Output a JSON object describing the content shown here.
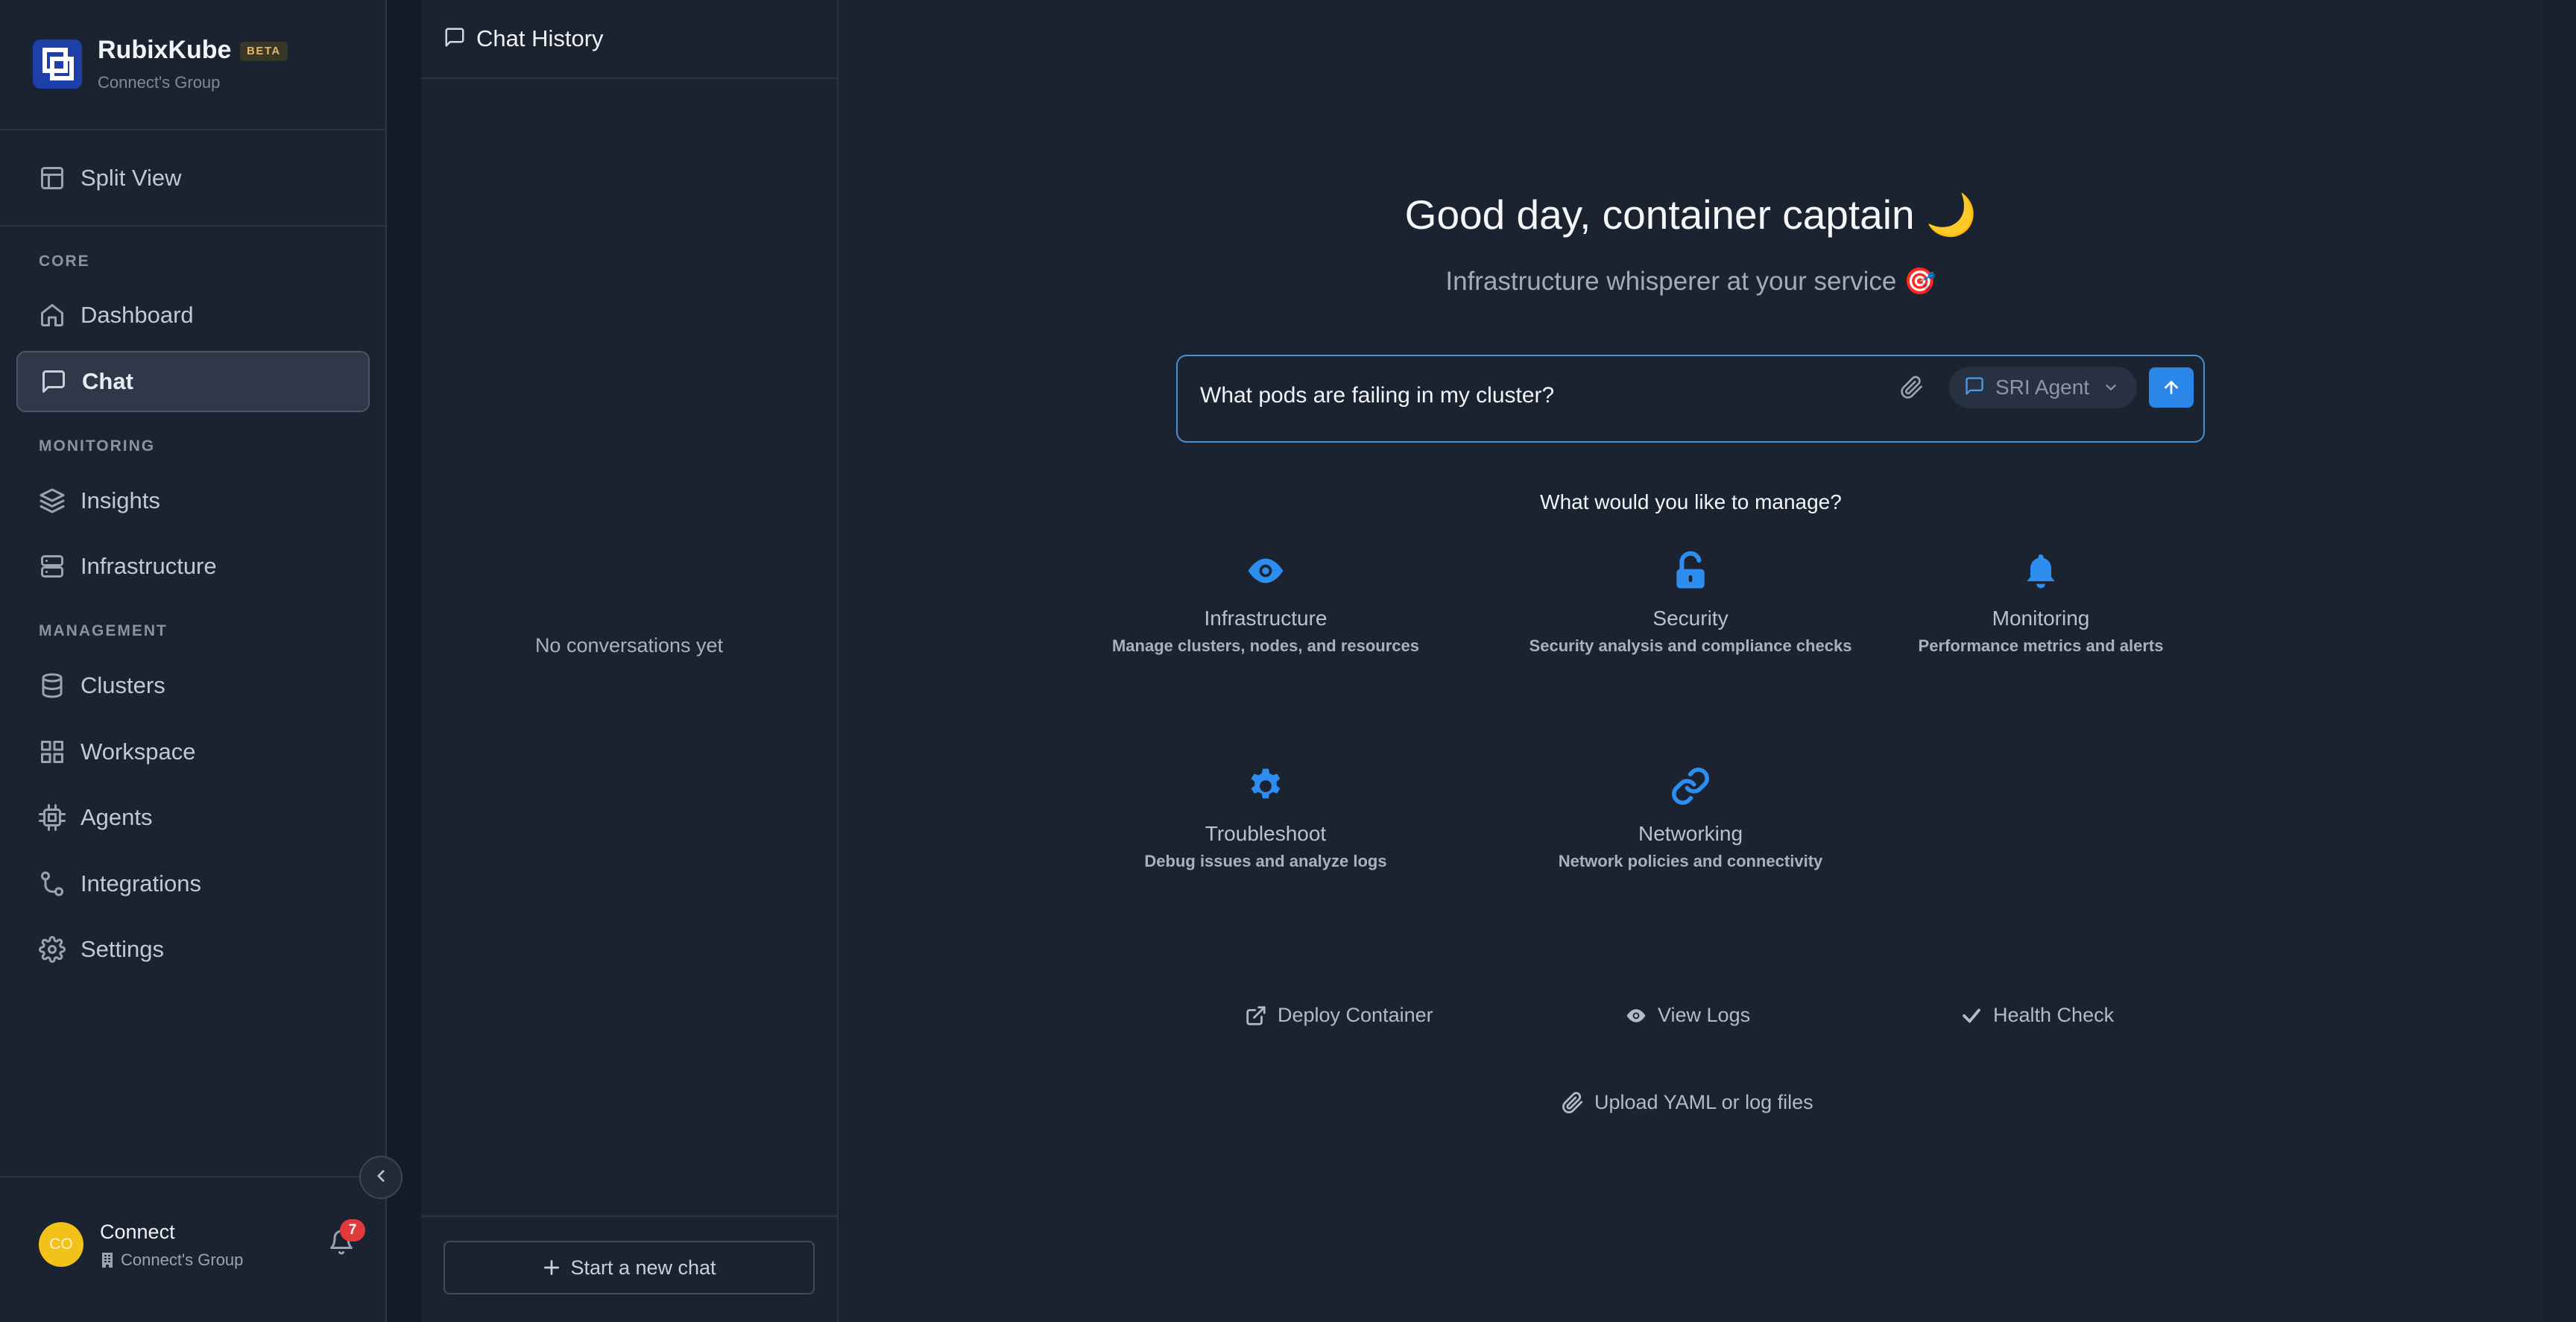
{
  "brand": {
    "name": "RubixKube",
    "badge": "BETA",
    "subtitle": "Connect's Group"
  },
  "sidebar": {
    "split_view": "Split View",
    "sections": [
      {
        "title": "CORE",
        "items": [
          {
            "label": "Dashboard",
            "icon": "home-icon"
          },
          {
            "label": "Chat",
            "icon": "chat-icon",
            "active": true
          }
        ]
      },
      {
        "title": "MONITORING",
        "items": [
          {
            "label": "Insights",
            "icon": "layers-icon"
          },
          {
            "label": "Infrastructure",
            "icon": "server-icon"
          }
        ]
      },
      {
        "title": "MANAGEMENT",
        "items": [
          {
            "label": "Clusters",
            "icon": "database-icon"
          },
          {
            "label": "Workspace",
            "icon": "grid-icon"
          },
          {
            "label": "Agents",
            "icon": "cpu-icon"
          },
          {
            "label": "Integrations",
            "icon": "route-icon"
          },
          {
            "label": "Settings",
            "icon": "gear-icon"
          }
        ]
      }
    ]
  },
  "user": {
    "initials": "CO",
    "name": "Connect",
    "group": "Connect's Group",
    "notifications": "7"
  },
  "history": {
    "title": "Chat History",
    "empty": "No conversations yet",
    "new_chat": "Start a new chat"
  },
  "main": {
    "greeting": "Good day, container captain 🌙",
    "subtitle": "Infrastructure whisperer at your service 🎯",
    "input_value": "What pods are failing in my cluster?",
    "agent": "SRI Agent",
    "manage_title": "What would you like to manage?",
    "cards": [
      {
        "title": "Infrastructure",
        "desc": "Manage clusters, nodes, and resources",
        "icon": "eye-icon"
      },
      {
        "title": "Security",
        "desc": "Security analysis and compliance checks",
        "icon": "lock-open-icon"
      },
      {
        "title": "Monitoring",
        "desc": "Performance metrics and alerts",
        "icon": "bell-icon"
      },
      {
        "title": "Troubleshoot",
        "desc": "Debug issues and analyze logs",
        "icon": "gear-icon"
      },
      {
        "title": "Networking",
        "desc": "Network policies and connectivity",
        "icon": "link-icon"
      }
    ],
    "actions": {
      "deploy": "Deploy Container",
      "logs": "View Logs",
      "health": "Health Check",
      "upload": "Upload YAML or log files"
    }
  },
  "colors": {
    "accent": "#2a86e8",
    "icon_blue": "#2e8ef0",
    "background": "#1b2230",
    "badge": "#e03a3a",
    "avatar": "#f2c21a"
  }
}
